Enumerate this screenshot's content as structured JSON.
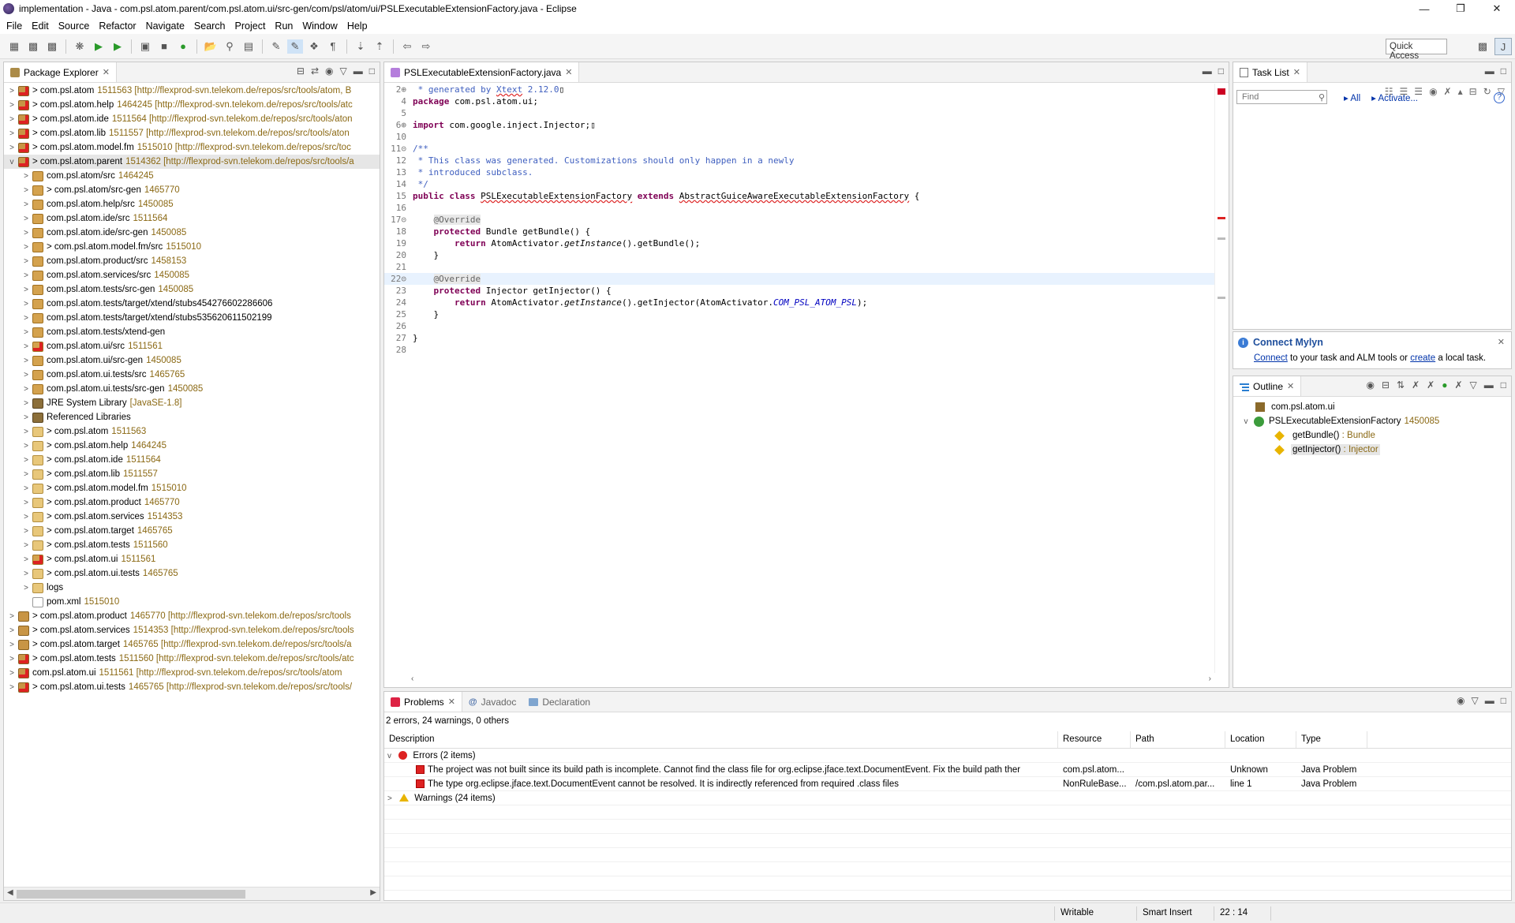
{
  "window": {
    "title": "implementation - Java - com.psl.atom.parent/com.psl.atom.ui/src-gen/com/psl/atom/ui/PSLExecutableExtensionFactory.java - Eclipse",
    "controls": [
      "—",
      "❐",
      "✕"
    ]
  },
  "menu": [
    "File",
    "Edit",
    "Source",
    "Refactor",
    "Navigate",
    "Search",
    "Project",
    "Run",
    "Window",
    "Help"
  ],
  "toolbar": {
    "quick_access": "Quick Access"
  },
  "package_explorer": {
    "tab": "Package Explorer",
    "rows": [
      {
        "tw": ">",
        "ind": 0,
        "icon": "projerr",
        "name": "> com.psl.atom",
        "dec": "1511563 [http://flexprod-svn.telekom.de/repos/src/tools/atom, B"
      },
      {
        "tw": ">",
        "ind": 0,
        "icon": "projerr",
        "name": "> com.psl.atom.help",
        "dec": "1464245 [http://flexprod-svn.telekom.de/repos/src/tools/atc"
      },
      {
        "tw": ">",
        "ind": 0,
        "icon": "projerr",
        "name": "> com.psl.atom.ide",
        "dec": "1511564 [http://flexprod-svn.telekom.de/repos/src/tools/aton"
      },
      {
        "tw": ">",
        "ind": 0,
        "icon": "projerr",
        "name": "> com.psl.atom.lib",
        "dec": "1511557 [http://flexprod-svn.telekom.de/repos/src/tools/aton"
      },
      {
        "tw": ">",
        "ind": 0,
        "icon": "projerr",
        "name": "> com.psl.atom.model.fm",
        "dec": "1515010 [http://flexprod-svn.telekom.de/repos/src/toc"
      },
      {
        "tw": "v",
        "ind": 0,
        "icon": "projerr",
        "name": "> com.psl.atom.parent",
        "dec": "1514362 [http://flexprod-svn.telekom.de/repos/src/tools/a",
        "sel": true
      },
      {
        "tw": ">",
        "ind": 1,
        "icon": "src",
        "name": "com.psl.atom/src",
        "dec": "1464245"
      },
      {
        "tw": ">",
        "ind": 1,
        "icon": "src",
        "name": "> com.psl.atom/src-gen",
        "dec": "1465770"
      },
      {
        "tw": ">",
        "ind": 1,
        "icon": "src",
        "name": "com.psl.atom.help/src",
        "dec": "1450085"
      },
      {
        "tw": ">",
        "ind": 1,
        "icon": "src",
        "name": "com.psl.atom.ide/src",
        "dec": "1511564"
      },
      {
        "tw": ">",
        "ind": 1,
        "icon": "src",
        "name": "com.psl.atom.ide/src-gen",
        "dec": "1450085"
      },
      {
        "tw": ">",
        "ind": 1,
        "icon": "src",
        "name": "> com.psl.atom.model.fm/src",
        "dec": "1515010"
      },
      {
        "tw": ">",
        "ind": 1,
        "icon": "src",
        "name": "com.psl.atom.product/src",
        "dec": "1458153"
      },
      {
        "tw": ">",
        "ind": 1,
        "icon": "src",
        "name": "com.psl.atom.services/src",
        "dec": "1450085"
      },
      {
        "tw": ">",
        "ind": 1,
        "icon": "src",
        "name": "com.psl.atom.tests/src-gen",
        "dec": "1450085"
      },
      {
        "tw": ">",
        "ind": 1,
        "icon": "src",
        "name": "com.psl.atom.tests/target/xtend/stubs454276602286606",
        "dec": ""
      },
      {
        "tw": ">",
        "ind": 1,
        "icon": "src",
        "name": "com.psl.atom.tests/target/xtend/stubs535620611502199",
        "dec": ""
      },
      {
        "tw": ">",
        "ind": 1,
        "icon": "src",
        "name": "com.psl.atom.tests/xtend-gen",
        "dec": ""
      },
      {
        "tw": ">",
        "ind": 1,
        "icon": "srcerr",
        "name": "com.psl.atom.ui/src",
        "dec": "1511561"
      },
      {
        "tw": ">",
        "ind": 1,
        "icon": "src",
        "name": "com.psl.atom.ui/src-gen",
        "dec": "1450085"
      },
      {
        "tw": ">",
        "ind": 1,
        "icon": "src",
        "name": "com.psl.atom.ui.tests/src",
        "dec": "1465765"
      },
      {
        "tw": ">",
        "ind": 1,
        "icon": "src",
        "name": "com.psl.atom.ui.tests/src-gen",
        "dec": "1450085"
      },
      {
        "tw": ">",
        "ind": 1,
        "icon": "lib",
        "name": "JRE System Library",
        "dec": "[JavaSE-1.8]"
      },
      {
        "tw": ">",
        "ind": 1,
        "icon": "lib",
        "name": "Referenced Libraries",
        "dec": ""
      },
      {
        "tw": ">",
        "ind": 1,
        "icon": "folder",
        "name": "> com.psl.atom",
        "dec": "1511563"
      },
      {
        "tw": ">",
        "ind": 1,
        "icon": "folder",
        "name": "> com.psl.atom.help",
        "dec": "1464245"
      },
      {
        "tw": ">",
        "ind": 1,
        "icon": "folder",
        "name": "> com.psl.atom.ide",
        "dec": "1511564"
      },
      {
        "tw": ">",
        "ind": 1,
        "icon": "folder",
        "name": "> com.psl.atom.lib",
        "dec": "1511557"
      },
      {
        "tw": ">",
        "ind": 1,
        "icon": "folder",
        "name": "> com.psl.atom.model.fm",
        "dec": "1515010"
      },
      {
        "tw": ">",
        "ind": 1,
        "icon": "folder",
        "name": "> com.psl.atom.product",
        "dec": "1465770"
      },
      {
        "tw": ">",
        "ind": 1,
        "icon": "folder",
        "name": "> com.psl.atom.services",
        "dec": "1514353"
      },
      {
        "tw": ">",
        "ind": 1,
        "icon": "folder",
        "name": "> com.psl.atom.target",
        "dec": "1465765"
      },
      {
        "tw": ">",
        "ind": 1,
        "icon": "folder",
        "name": "> com.psl.atom.tests",
        "dec": "1511560"
      },
      {
        "tw": ">",
        "ind": 1,
        "icon": "srcerr",
        "name": "> com.psl.atom.ui",
        "dec": "1511561"
      },
      {
        "tw": ">",
        "ind": 1,
        "icon": "folder",
        "name": "> com.psl.atom.ui.tests",
        "dec": "1465765"
      },
      {
        "tw": ">",
        "ind": 1,
        "icon": "folder",
        "name": "logs",
        "dec": ""
      },
      {
        "tw": "",
        "ind": 1,
        "icon": "file",
        "name": "pom.xml",
        "dec": "1515010"
      },
      {
        "tw": ">",
        "ind": 0,
        "icon": "proj",
        "name": "> com.psl.atom.product",
        "dec": "1465770 [http://flexprod-svn.telekom.de/repos/src/tools"
      },
      {
        "tw": ">",
        "ind": 0,
        "icon": "proj",
        "name": "> com.psl.atom.services",
        "dec": "1514353 [http://flexprod-svn.telekom.de/repos/src/tools"
      },
      {
        "tw": ">",
        "ind": 0,
        "icon": "proj",
        "name": "> com.psl.atom.target",
        "dec": "1465765 [http://flexprod-svn.telekom.de/repos/src/tools/a"
      },
      {
        "tw": ">",
        "ind": 0,
        "icon": "projerr",
        "name": "> com.psl.atom.tests",
        "dec": "1511560 [http://flexprod-svn.telekom.de/repos/src/tools/atc"
      },
      {
        "tw": ">",
        "ind": 0,
        "icon": "projerr",
        "name": "com.psl.atom.ui",
        "dec": "1511561 [http://flexprod-svn.telekom.de/repos/src/tools/atom"
      },
      {
        "tw": ">",
        "ind": 0,
        "icon": "projerr",
        "name": "> com.psl.atom.ui.tests",
        "dec": "1465765 [http://flexprod-svn.telekom.de/repos/src/tools/"
      }
    ]
  },
  "editor": {
    "tab": "PSLExecutableExtensionFactory.java",
    "lines": [
      {
        "n": "2⊕",
        "html": "<span class='cm'> * generated by <span class='err'>Xtext</span> 2.12.0</span>▯"
      },
      {
        "n": "4",
        "html": "<span class='kw'>package</span> com.psl.atom.ui;"
      },
      {
        "n": "5",
        "html": ""
      },
      {
        "n": "6⊕",
        "html": "<span class='kw'>import</span> com.google.inject.Injector;▯"
      },
      {
        "n": "10",
        "html": ""
      },
      {
        "n": "11⊝",
        "html": "<span class='cm'>/**</span>"
      },
      {
        "n": "12",
        "html": "<span class='cm'> * This class was generated. Customizations should only happen in a newly</span>"
      },
      {
        "n": "13",
        "html": "<span class='cm'> * introduced subclass.</span>"
      },
      {
        "n": "14",
        "html": "<span class='cm'> */</span>"
      },
      {
        "n": "15",
        "html": "<span class='kw'>public class</span> <span class='err'>PSLExecutableExtensionFactory</span> <span class='kw'>extends</span> <span class='err'>AbstractGuiceAwareExecutableExtensionFactory</span> {"
      },
      {
        "n": "16",
        "html": ""
      },
      {
        "n": "17⊝",
        "html": "    <span class='ann'>@Override</span>"
      },
      {
        "n": "18",
        "html": "    <span class='kw'>protected</span> Bundle getBundle() {"
      },
      {
        "n": "19",
        "html": "        <span class='kw'>return</span> AtomActivator.<span class='it'>getInstance</span>().getBundle();"
      },
      {
        "n": "20",
        "html": "    }"
      },
      {
        "n": "21",
        "html": ""
      },
      {
        "n": "22⊝",
        "html": "    <span class='ann'>@Override</span>",
        "cur": true
      },
      {
        "n": "23",
        "html": "    <span class='kw'>protected</span> Injector getInjector() {"
      },
      {
        "n": "24",
        "html": "        <span class='kw'>return</span> AtomActivator.<span class='it'>getInstance</span>().getInjector(AtomActivator.<span class='fld'>COM_PSL_ATOM_PSL</span>);"
      },
      {
        "n": "25",
        "html": "    }"
      },
      {
        "n": "26",
        "html": ""
      },
      {
        "n": "27",
        "html": "}"
      },
      {
        "n": "28",
        "html": ""
      }
    ]
  },
  "task_list": {
    "tab": "Task List",
    "find_placeholder": "Find",
    "all": "All",
    "activate": "Activate...",
    "mylyn_title": "Connect Mylyn",
    "mylyn_connect": "Connect",
    "mylyn_mid": " to your task and ALM tools or ",
    "mylyn_create": "create",
    "mylyn_end": " a local task."
  },
  "outline": {
    "tab": "Outline",
    "package": "com.psl.atom.ui",
    "class": "PSLExecutableExtensionFactory",
    "class_rev": "1450085",
    "methods": [
      {
        "name": "getBundle()",
        "type": " : Bundle"
      },
      {
        "name": "getInjector()",
        "type": " : Injector",
        "sel": true
      }
    ]
  },
  "problems": {
    "tabs": [
      "Problems",
      "Javadoc",
      "Declaration"
    ],
    "summary": "2 errors, 24 warnings, 0 others",
    "headers": [
      "Description",
      "Resource",
      "Path",
      "Location",
      "Type"
    ],
    "errors_group": "Errors (2 items)",
    "warnings_group": "Warnings (24 items)",
    "rows": [
      {
        "desc": "The project was not built since its build path is incomplete. Cannot find the class file for org.eclipse.jface.text.DocumentEvent. Fix the build path ther",
        "res": "com.psl.atom...",
        "path": "",
        "loc": "Unknown",
        "type": "Java Problem"
      },
      {
        "desc": "The type org.eclipse.jface.text.DocumentEvent cannot be resolved. It is indirectly referenced from required .class files",
        "res": "NonRuleBase...",
        "path": "/com.psl.atom.par...",
        "loc": "line 1",
        "type": "Java Problem"
      }
    ]
  },
  "status": {
    "writable": "Writable",
    "insert": "Smart Insert",
    "position": "22 : 14"
  }
}
